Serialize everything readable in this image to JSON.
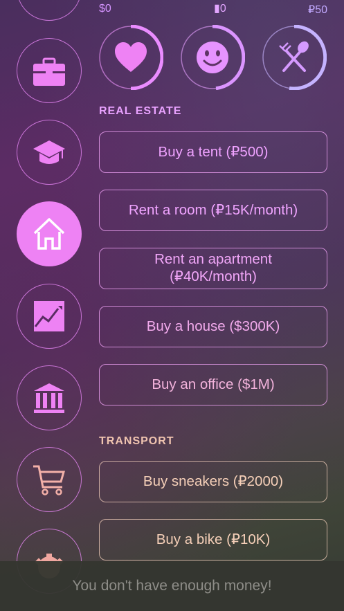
{
  "stats": {
    "money_min": "$0",
    "money_mid": "0",
    "money_max": "₽50"
  },
  "sections": {
    "real_estate": "REAL ESTATE",
    "transport": "TRANSPORT"
  },
  "real_estate_items": [
    "Buy a tent (₽500)",
    "Rent a room (₽15K/month)",
    "Rent an apartment (₽40K/month)",
    "Buy a house ($300K)",
    "Buy an office ($1M)"
  ],
  "transport_items": [
    "Buy sneakers (₽2000)",
    "Buy a bike (₽10K)"
  ],
  "toast": "You don't have enough money!",
  "colors": {
    "accent": "#ee82f4",
    "toast_bg": "#343630",
    "toast_text": "#8e8d88"
  },
  "rings": [
    {
      "icon": "heart-icon",
      "level": 0.48
    },
    {
      "icon": "smiley-icon",
      "level": 0.45
    },
    {
      "icon": "fork-spoon-icon",
      "level": 0.55
    }
  ]
}
